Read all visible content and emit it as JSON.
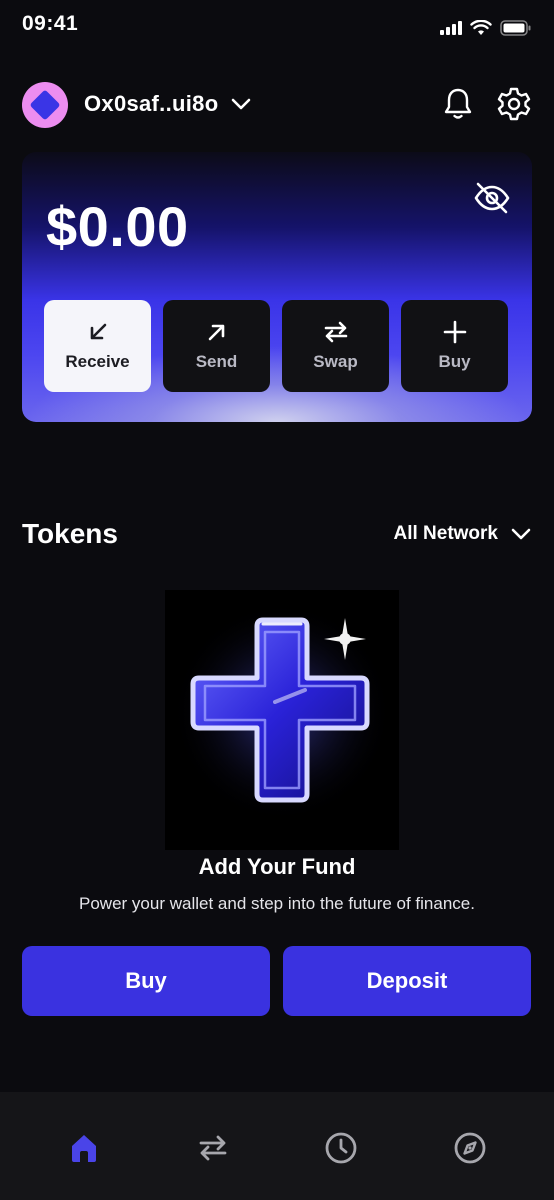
{
  "status_bar": {
    "time": "09:41"
  },
  "header": {
    "address": "Ox0saf..ui8o"
  },
  "balance": {
    "amount": "$0.00"
  },
  "actions": [
    {
      "label": "Receive",
      "icon": "arrow-down-left-icon",
      "active": true
    },
    {
      "label": "Send",
      "icon": "arrow-up-right-icon",
      "active": false
    },
    {
      "label": "Swap",
      "icon": "swap-icon",
      "active": false
    },
    {
      "label": "Buy",
      "icon": "plus-icon",
      "active": false
    }
  ],
  "tokens": {
    "title": "Tokens",
    "network_filter": "All Network"
  },
  "empty_state": {
    "title": "Add Your Fund",
    "description": "Power your wallet and step into the future of finance."
  },
  "buttons": {
    "buy": "Buy",
    "deposit": "Deposit"
  },
  "bottom_nav": [
    {
      "icon": "home-icon",
      "active": true
    },
    {
      "icon": "swap-icon",
      "active": false
    },
    {
      "icon": "clock-icon",
      "active": false
    },
    {
      "icon": "compass-icon",
      "active": false
    }
  ],
  "colors": {
    "background": "#0b0b0f",
    "accent": "#3a32e0",
    "avatar": "#ec8df0",
    "nav_active": "#4a44e8"
  }
}
